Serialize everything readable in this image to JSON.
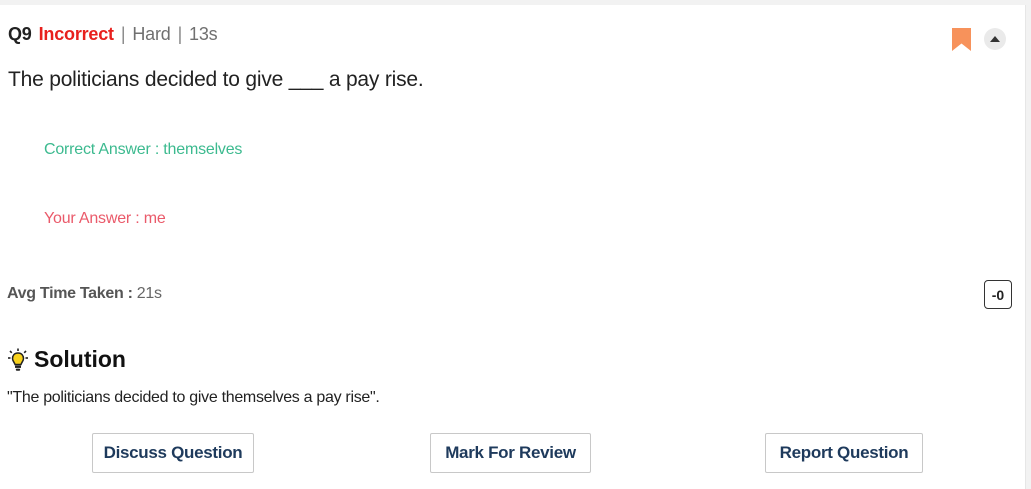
{
  "header": {
    "question_number": "Q9",
    "status": "Incorrect",
    "separator": "|",
    "difficulty": "Hard",
    "time_spent": "13s"
  },
  "icons": {
    "bookmark": "bookmark-icon",
    "collapse": "chevron-up-icon",
    "solution": "lightbulb-icon"
  },
  "colors": {
    "incorrect": "#e8201d",
    "correct_answer": "#3cba8f",
    "your_answer": "#ea5a6a",
    "bookmark": "#f7925b",
    "button_text": "#1e3a5c"
  },
  "question": {
    "text": "The politicians decided to give ___ a pay rise."
  },
  "answers": {
    "correct": "Correct Answer : themselves",
    "yours": "Your Answer : me"
  },
  "stats": {
    "avg_time_label": "Avg Time Taken :",
    "avg_time_value": "21s",
    "score": "-0"
  },
  "solution": {
    "title": "Solution",
    "text": "\"The politicians decided to give themselves a pay rise\"."
  },
  "buttons": {
    "discuss": "Discuss Question",
    "mark": "Mark For Review",
    "report": "Report Question"
  }
}
